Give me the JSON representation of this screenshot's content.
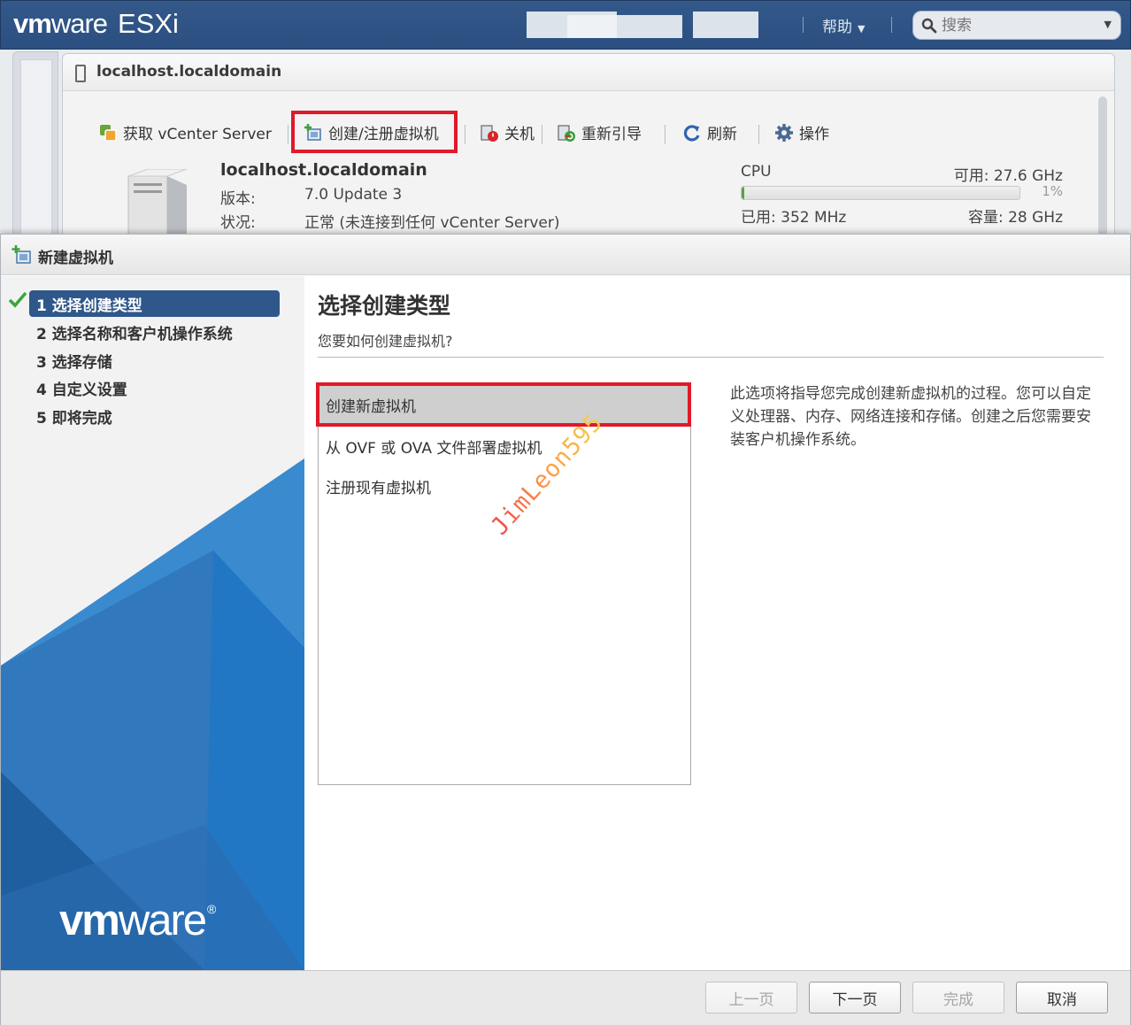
{
  "header": {
    "brand_vm": "vm",
    "brand_ware": "ware",
    "brand_product": "ESXi",
    "help_label": "帮助",
    "search_placeholder": "搜索"
  },
  "host_panel": {
    "title": "localhost.localdomain",
    "toolbar": {
      "vcenter": "获取 vCenter Server",
      "create_register": "创建/注册虚拟机",
      "shutdown": "关机",
      "reboot": "重新引导",
      "refresh": "刷新",
      "actions": "操作"
    },
    "host_name": "localhost.localdomain",
    "version_label": "版本:",
    "version_value": "7.0 Update 3",
    "state_label": "状况:",
    "state_value": "正常 (未连接到任何 vCenter Server)",
    "cpu": {
      "label": "CPU",
      "available": "可用: 27.6 GHz",
      "percent_text": "1%",
      "percent": 1,
      "used": "已用: 352 MHz",
      "capacity": "容量: 28 GHz"
    }
  },
  "dialog": {
    "title": "新建虚拟机",
    "steps": [
      {
        "label": "1 选择创建类型"
      },
      {
        "label": "2 选择名称和客户机操作系统"
      },
      {
        "label": "3 选择存储"
      },
      {
        "label": "4 自定义设置"
      },
      {
        "label": "5 即将完成"
      }
    ],
    "logo_vm": "vm",
    "logo_ware": "ware",
    "logo_reg": "®",
    "content_title": "选择创建类型",
    "content_subtitle": "您要如何创建虚拟机?",
    "options": [
      {
        "label": "创建新虚拟机"
      },
      {
        "label": "从 OVF 或 OVA 文件部署虚拟机"
      },
      {
        "label": "注册现有虚拟机"
      }
    ],
    "description": "此选项将指导您完成创建新虚拟机的过程。您可以自定义处理器、内存、网络连接和存储。创建之后您需要安装客户机操作系统。",
    "watermark": "JimLeon595",
    "buttons": {
      "back": "上一页",
      "next": "下一页",
      "finish": "完成",
      "cancel": "取消"
    }
  },
  "colors": {
    "header_blue": "#2b4f80",
    "step_active": "#2f578a",
    "highlight_red": "#e0192b",
    "option_selected": "#cfcfcf",
    "cpu_fill": "#5aa33a"
  },
  "icons": {
    "search": "magnifier-icon",
    "check": "checkmark-icon",
    "vm_new": "new-vm-icon",
    "refresh": "refresh-icon",
    "gear": "gear-icon"
  }
}
